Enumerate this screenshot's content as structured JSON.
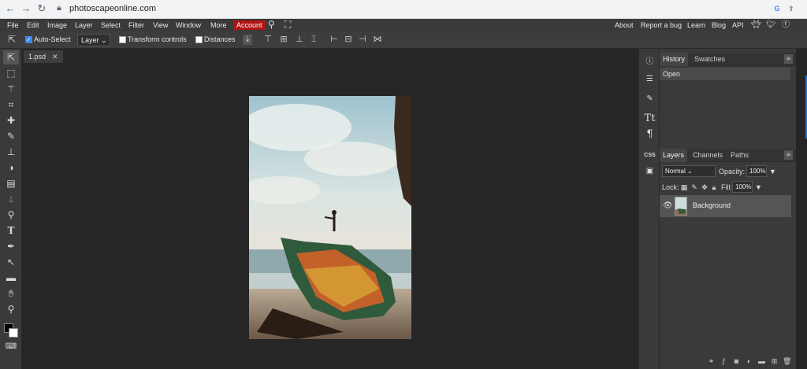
{
  "browser": {
    "url": "photoscapeonline.com",
    "back": "←",
    "forward": "→",
    "reload": "↻"
  },
  "menu": {
    "items": [
      "File",
      "Edit",
      "Image",
      "Layer",
      "Select",
      "Filter",
      "View",
      "Window",
      "More"
    ],
    "account": "Account",
    "right_links": [
      "About",
      "Report a bug",
      "Learn",
      "Blog",
      "API"
    ]
  },
  "options": {
    "auto_select_label": "Auto-Select",
    "auto_select_checked": true,
    "layer_select": "Layer",
    "transform_controls_label": "Transform controls",
    "transform_controls_checked": false,
    "distances_label": "Distances",
    "distances_checked": false
  },
  "document": {
    "tab_name": "1.psd",
    "tab_close": "✕"
  },
  "history_panel": {
    "tabs": [
      "History",
      "Swatches"
    ],
    "active_tab": "History",
    "entries": [
      "Open"
    ]
  },
  "layers_panel": {
    "tabs": [
      "Layers",
      "Channels",
      "Paths"
    ],
    "active_tab": "Layers",
    "blend_mode": "Normal",
    "opacity_label": "Opacity:",
    "opacity_value": "100%",
    "lock_label": "Lock:",
    "fill_label": "Fill:",
    "fill_value": "100%",
    "layers": [
      {
        "name": "Background",
        "visible": true
      }
    ]
  },
  "right_icons": {
    "css_label": "CSS",
    "text_glyph": "Tt",
    "paragraph_glyph": "¶"
  },
  "colors": {
    "foreground": "#000000",
    "background": "#ffffff",
    "account_bg": "#b01515"
  }
}
